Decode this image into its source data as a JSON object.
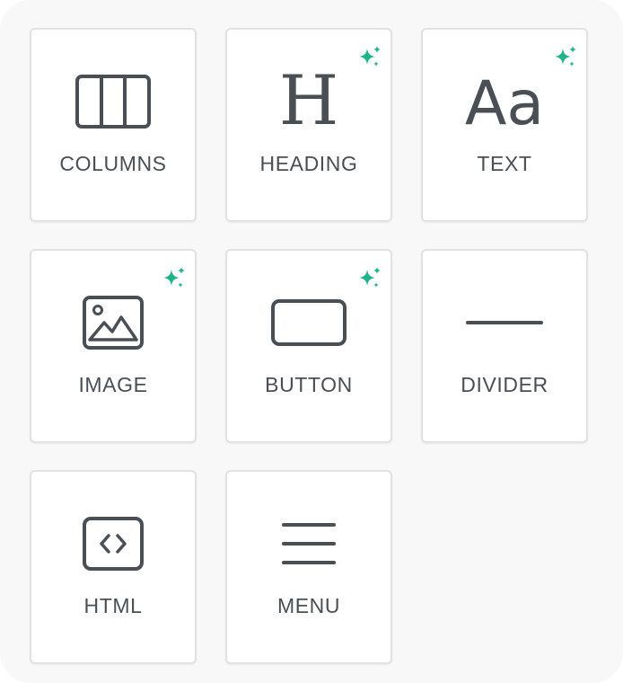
{
  "blocks": [
    {
      "label": "COLUMNS",
      "icon": "columns-icon",
      "ai": false
    },
    {
      "label": "HEADING",
      "icon": "heading-icon",
      "ai": true
    },
    {
      "label": "TEXT",
      "icon": "text-icon",
      "ai": true
    },
    {
      "label": "IMAGE",
      "icon": "image-icon",
      "ai": true
    },
    {
      "label": "BUTTON",
      "icon": "button-icon",
      "ai": true
    },
    {
      "label": "DIVIDER",
      "icon": "divider-icon",
      "ai": false
    },
    {
      "label": "HTML",
      "icon": "html-icon",
      "ai": false
    },
    {
      "label": "MENU",
      "icon": "menu-icon",
      "ai": false
    }
  ],
  "icon_glyphs": {
    "heading": "H",
    "text": "Aa"
  },
  "ai_badge_icon": "sparkles-icon",
  "colors": {
    "icon": "#4a4f55",
    "label": "#4a4f55",
    "ai_accent": "#1db48a",
    "tile_border": "#e2e2e2",
    "panel_background": "#f8f8f8"
  }
}
